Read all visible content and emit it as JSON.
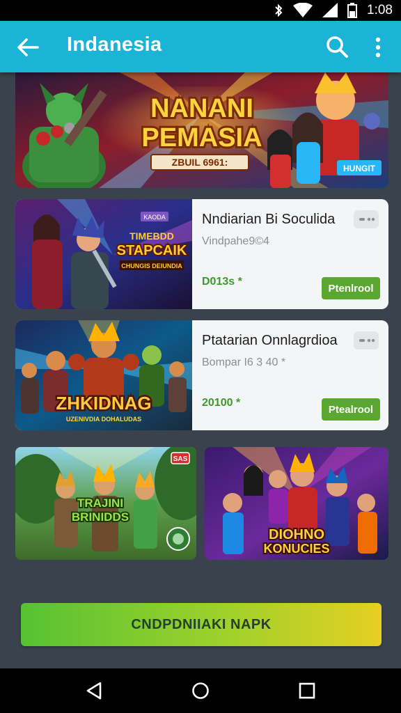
{
  "status_bar": {
    "time": "1:08",
    "icons": [
      "bluetooth-icon",
      "wifi-icon",
      "signal-icon",
      "battery-icon"
    ]
  },
  "app_bar": {
    "title": "Indanesia",
    "back_icon": "arrow-left-icon",
    "search_icon": "search-icon",
    "more_icon": "more-vert-icon",
    "color": "#1cb4d6"
  },
  "banner": {
    "title_line1": "NANANI",
    "title_line2": "PEMASIA",
    "ribbon": "ZBUIL 6961:",
    "badge": "HUNGIT"
  },
  "cards": [
    {
      "art_line1": "TIMEBDD",
      "art_line2": "STAPCAIK",
      "art_line3": "CHUNGIS DEIUNDIA",
      "art_tag": "KAODA",
      "name": "Nndiarian Bi Soculida",
      "subtitle": "Vindpahe9©4",
      "price": "D013s *",
      "button": "Ptenlrool"
    },
    {
      "art_line1": "ZHKIDNAG",
      "art_line2": "UZENIVDIA DOHALUDAS",
      "name": "Ptatarian Onnlagrdioa",
      "subtitle": "Bompar  I6 3 40 *",
      "price": "20100 *",
      "button": "Ptealrool"
    }
  ],
  "tiles": [
    {
      "art_line1": "TRAJINI",
      "art_line2": "BRINIDDS",
      "tag": "SAS"
    },
    {
      "art_line1": "DIOHNO",
      "art_line2": "KONUCIES"
    }
  ],
  "cta": {
    "label": "CNDPDNIIAKI NAPK"
  },
  "nav_bar": {
    "icons": [
      "back-triangle-icon",
      "home-circle-icon",
      "recents-square-icon"
    ]
  },
  "colors": {
    "accent": "#1cb4d6",
    "install_green": "#5aa832",
    "price_green": "#3c9a2c",
    "background": "#3a434d"
  }
}
